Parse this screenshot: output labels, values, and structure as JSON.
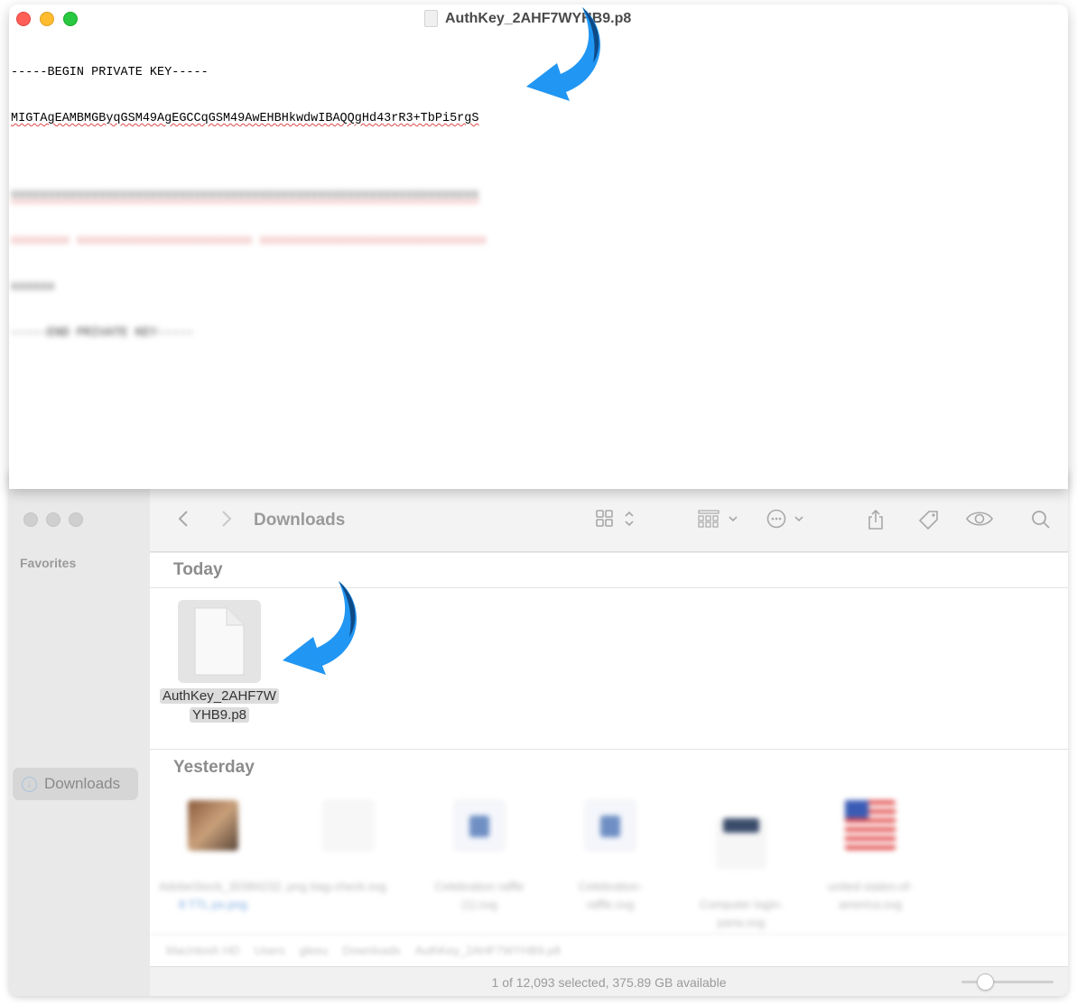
{
  "editor": {
    "title": "AuthKey_2AHF7WYHB9.p8",
    "line1": "-----BEGIN PRIVATE KEY-----",
    "line2": "MIGTAgEAMBMGByqGSM49AgEGCCqGSM49AwEHBHkwdwIBAQQgHd43rR3+TbPi5rgS",
    "line3": "xxxxxxxxxxxxxxxxxxxxxxxxxxxxxxxxxxxxxxxxxxxxxxxxxxxxxxxxxxxxxxxx",
    "line4": "xxxxxxxx xxxxxxxxxxxxxxxxxxxxxxxx xxxxxxxxxxxxxxxxxxxxxxxxxxxxxxx",
    "line5": "xxxxxx",
    "line6": "-----END PRIVATE KEY-----"
  },
  "finder": {
    "location_title": "Downloads",
    "sidebar": {
      "favorites_heading": "Favorites",
      "downloads_label": "Downloads"
    },
    "sections": {
      "today": "Today",
      "yesterday": "Yesterday"
    },
    "today_file": {
      "name_line1": "AuthKey_2AHF7W",
      "name_line2": "YHB9.p8"
    },
    "yesterday_files": [
      {
        "name": "AdobeStock_30384232..png",
        "sub": "8 TTL px.png"
      },
      {
        "name": "bag-check.svg",
        "sub": ""
      },
      {
        "name": "Celebration raffle",
        "sub": "(1).svg"
      },
      {
        "name": "Celebration-",
        "sub": "raffle.svg"
      },
      {
        "name": "Computer login-",
        "sub": "pana.svg"
      },
      {
        "name": "united-states-of-",
        "sub": "america.svg"
      }
    ],
    "path_bar": [
      "Macintosh HD",
      "Users",
      "gleeu",
      "Downloads",
      "AuthKey_2AHF7WYHB9.p8"
    ],
    "status": "1 of 12,093 selected, 375.89 GB available",
    "icon_size_fraction": 0.25
  },
  "colors": {
    "arrow_light": "#2196f3",
    "arrow_dark": "#0d4a86",
    "close": "#ff5f57",
    "minimize": "#febc2e",
    "zoom": "#28c840"
  }
}
